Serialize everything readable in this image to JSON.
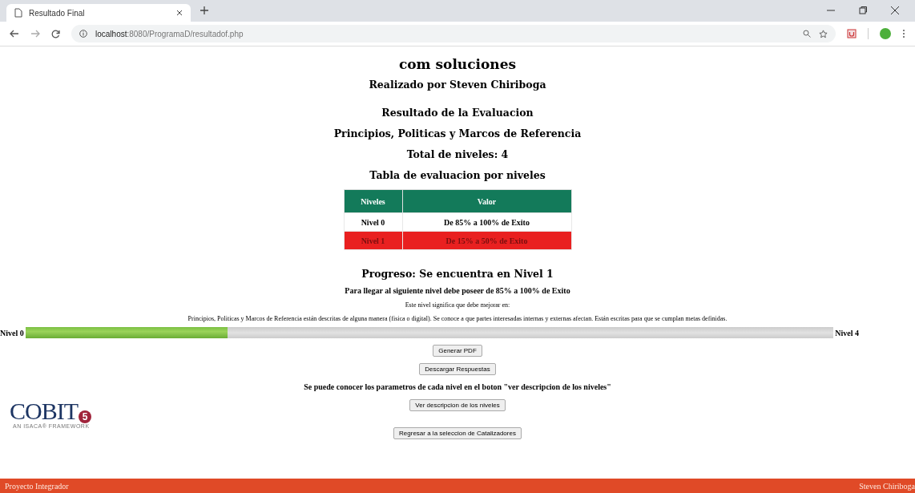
{
  "browser": {
    "tab_title": "Resultado Final",
    "url_host": "localhost",
    "url_rest": ":8080/ProgramaD/resultadof.php"
  },
  "page": {
    "title": "com soluciones",
    "author": "Realizado por Steven Chiriboga",
    "headings": [
      "Resultado de la Evaluacion",
      "Principios, Politicas y Marcos de Referencia",
      "Total de niveles: 4",
      "Tabla de evaluacion por niveles"
    ],
    "table": {
      "columns": [
        "Niveles",
        "Valor"
      ],
      "rows": [
        {
          "cells": [
            "Nivel 0",
            "De 85% a 100% de Exito"
          ],
          "current": false
        },
        {
          "cells": [
            "Nivel 1",
            "De 15% a 50% de Exito"
          ],
          "current": true
        }
      ]
    },
    "progress_title": "Progreso: Se encuentra en Nivel 1",
    "next_level": "Para llegar al siguiente nivel debe poseer de 85% a 100% de Exito",
    "meaning": "Este nivel significa que debe mejorar en:",
    "description": "Principios, Politicas y Marcos de Referencia están descritas de alguna manera (fisica o digital). Se conoce a que partes interesadas internas y externas afectan. Están escritas para que se cumplan metas definidas.",
    "progress": {
      "start_label": "Nivel 0",
      "end_label": "Nivel 4",
      "level": 0.25
    },
    "buttons_top": [
      "Generar PDF",
      "Descargar Respuestas"
    ],
    "hint": "Se puede conocer los parametros de cada nivel en el boton \"ver descripcion de los niveles\"",
    "buttons_bottom": [
      "Ver descripcion de los niveles",
      "Regresar a la seleccion de Catalizadores"
    ],
    "logo": {
      "name": "COBIT",
      "number": "5",
      "tagline": "AN ISACA® FRAMEWORK"
    }
  },
  "footer": {
    "left": "Proyecto Integrador",
    "right": "Steven Chiriboga"
  }
}
